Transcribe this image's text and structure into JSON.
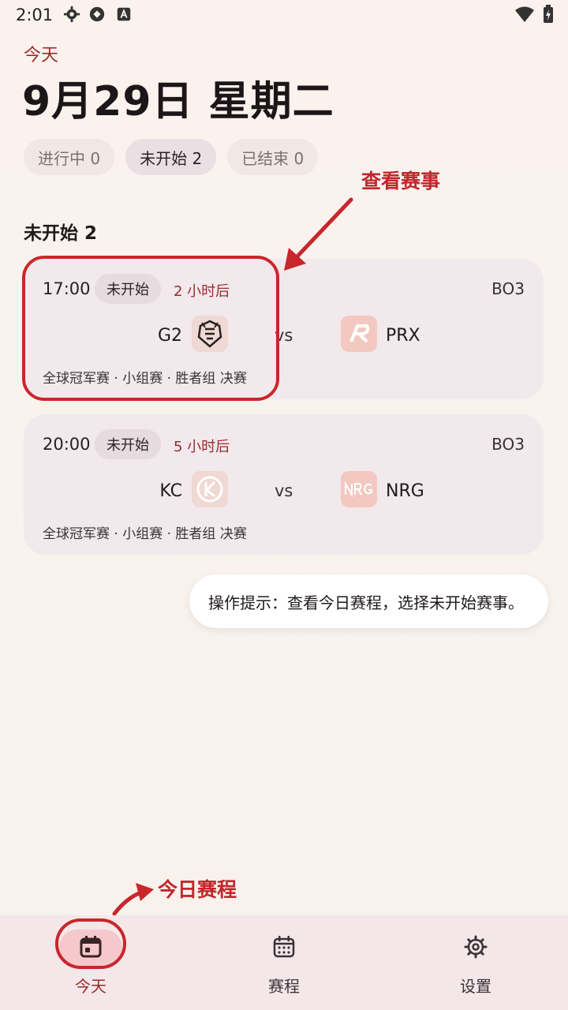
{
  "status_bar": {
    "time": "2:01"
  },
  "header": {
    "today_label": "今天",
    "date_title": "9月29日 星期二"
  },
  "filters": [
    {
      "label": "进行中 0",
      "state": "inactive"
    },
    {
      "label": "未开始 2",
      "state": "active"
    },
    {
      "label": "已结束 0",
      "state": "inactive"
    }
  ],
  "annotations": {
    "view_match": "查看赛事",
    "today_schedule": "今日赛程"
  },
  "section": {
    "title": "未开始 2"
  },
  "matches": [
    {
      "time": "17:00",
      "status": "未开始",
      "countdown": "2 小时后",
      "format": "BO3",
      "team_a": "G2",
      "team_b": "PRX",
      "league": "全球冠军赛 · 小组赛 · 胜者组 决赛"
    },
    {
      "time": "20:00",
      "status": "未开始",
      "countdown": "5 小时后",
      "format": "BO3",
      "team_a": "KC",
      "team_b": "NRG",
      "league": "全球冠军赛 · 小组赛 · 胜者组 决赛"
    }
  ],
  "tip": "操作提示：查看今日赛程，选择未开始赛事。",
  "bottom_nav": [
    {
      "label": "今天",
      "icon": "calendar-today-icon",
      "active": true
    },
    {
      "label": "赛程",
      "icon": "calendar-grid-icon",
      "active": false
    },
    {
      "label": "设置",
      "icon": "gear-icon",
      "active": false
    }
  ],
  "colors": {
    "accent": "#9c2a2e",
    "annotation": "#c9262c",
    "card": "#f1e9ec",
    "nav_active": "#f5c9cc"
  }
}
